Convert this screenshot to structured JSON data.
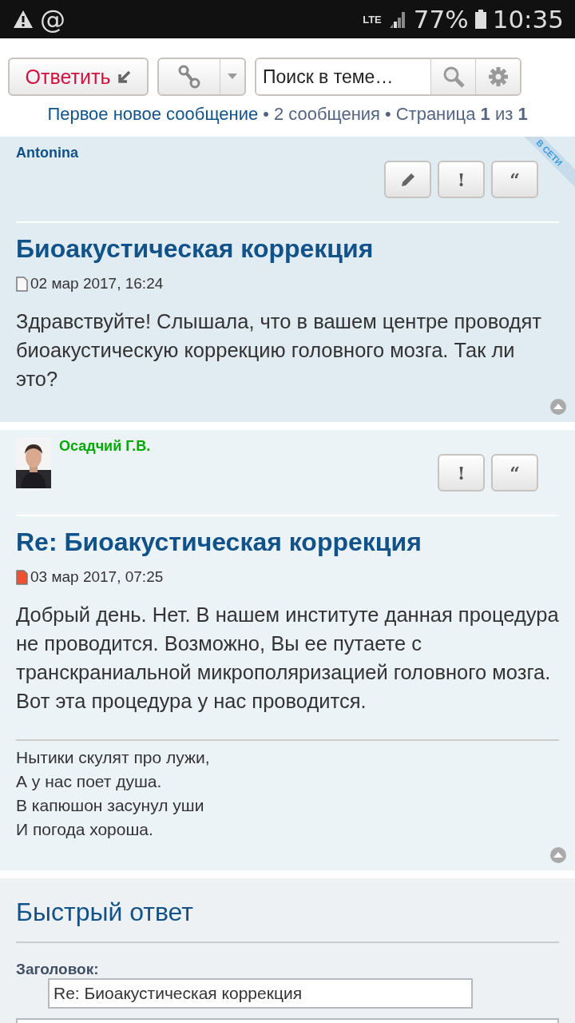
{
  "status_bar": {
    "icons": [
      "@"
    ],
    "network": "LTE",
    "battery": "77%",
    "time": "10:35"
  },
  "toolbar": {
    "reply_button": "Ответить",
    "search": {
      "placeholder": "Поиск в теме…"
    }
  },
  "pagination": {
    "first_unread": "Первое новое сообщение",
    "separator_1": "•",
    "count": "2 сообщения",
    "separator_2": "•",
    "page": "Страница **1** из **1**"
  },
  "posts": [
    {
      "author": "Antonina",
      "color": "#105289",
      "online_badge": "В СЕТИ",
      "buttons": [
        {
          "kind": "edit"
        },
        {
          "kind": "report",
          "label": "!"
        },
        {
          "kind": "quote",
          "label": "“"
        }
      ],
      "title": "Биоакустическая коррекция",
      "unread": false,
      "date": "02 мар 2017, 16:24",
      "body": "Здравствуйте! Слышала, что в вашем центре проводят биоакустическую коррекцию головного мозга. Так ли это?"
    },
    {
      "author": "Осадчий Г.В.",
      "color": "#00aa00",
      "avatar": {
        "kind": "picture"
      },
      "buttons": [
        {
          "kind": "report",
          "label": "!"
        },
        {
          "kind": "quote",
          "label": "“"
        }
      ],
      "title": "Re: Биоакустическая коррекция",
      "unread": true,
      "date": "03 мар 2017, 07:25",
      "body": "Добрый день. Нет. В нашем институте данная процедура не проводится. Возможно, Вы ее путаете с транскраниальной микрополяризацией головного мозга. Вот эта процедура у нас проводится.",
      "signature": [
        "Нытики скулят про лужи,",
        "А у нас поет душа.",
        "В капюшон засунул уши",
        "И погода хороша."
      ]
    }
  ],
  "quick_reply": {
    "title": "Быстрый ответ",
    "subject_label": "Заголовок:",
    "subject_value": "Re: Биоакустическая коррекция"
  }
}
